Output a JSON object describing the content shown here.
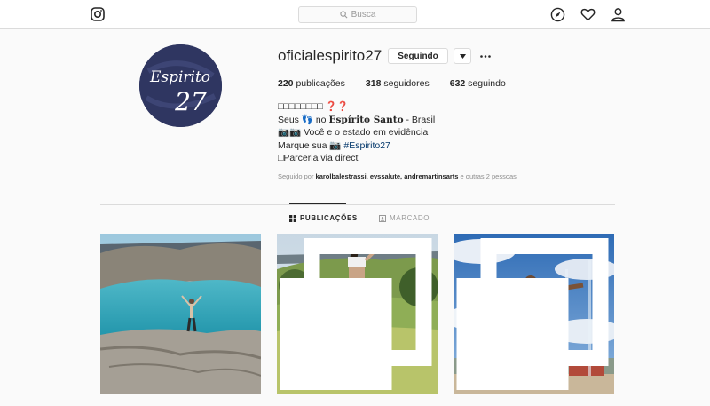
{
  "nav": {
    "search_placeholder": "Busca",
    "icons": [
      "instagram-icon",
      "search-icon",
      "compass-icon",
      "heart-icon",
      "user-icon"
    ]
  },
  "profile": {
    "username": "oficialespirito27",
    "follow_button": "Seguindo",
    "avatar_text": "Espirito27",
    "stats": [
      {
        "count": "220",
        "label": " publicações"
      },
      {
        "count": "318",
        "label": " seguidores"
      },
      {
        "count": "632",
        "label": " seguindo"
      }
    ],
    "bio": {
      "line1": "□□□□□□□□ ❓❓",
      "line2_a": "Seus 👣 no ",
      "line2_b": "Espírito Santo",
      "line2_c": " - Brasil",
      "line3": "📷📷 Você e o estado em evidência",
      "line4_a": "Marque sua 📷 ",
      "line4_tag": "#Espirito27",
      "line5": "□Parceria via direct"
    },
    "followed_by": {
      "prefix": "Seguido por ",
      "users": "karolbalestrassi, evssalute, andremartinsarts",
      "suffix": " e outras 2 pessoas"
    }
  },
  "tabs": [
    {
      "label": "PUBLICAÇÕES",
      "active": true
    },
    {
      "label": "MARCADO",
      "active": false
    }
  ],
  "posts": [
    {
      "description": "lagoon-rock-photo",
      "multi": false
    },
    {
      "description": "woman-field-photo",
      "multi": true
    },
    {
      "description": "man-sky-photo",
      "multi": true
    }
  ],
  "colors": {
    "accent_link": "#003569",
    "avatar_bg": "#2f3661",
    "border": "#dbdbdb"
  }
}
